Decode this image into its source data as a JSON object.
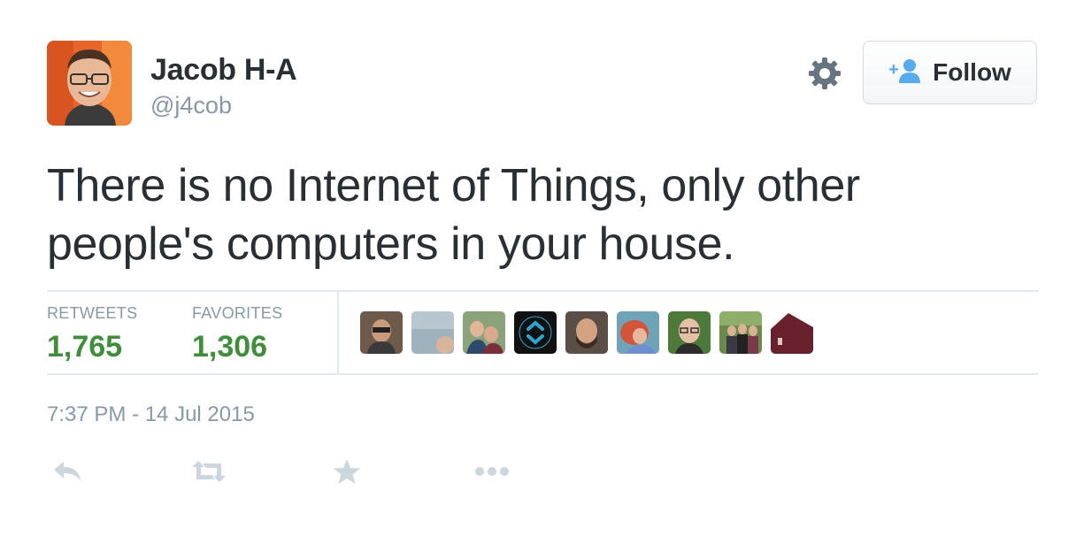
{
  "user": {
    "fullname": "Jacob H-A",
    "username": "@j4cob"
  },
  "follow_button": {
    "label": "Follow"
  },
  "tweet": {
    "text_line1": "There is no Internet of Things, only other",
    "text_line2": "people's computers in your house."
  },
  "stats": {
    "retweets_label": "RETWEETS",
    "retweets_value": "1,765",
    "favorites_label": "FAVORITES",
    "favorites_value": "1,306"
  },
  "timestamp": "7:37 PM - 14 Jul 2015",
  "icons": {
    "settings": "gear-icon",
    "follow": "person-plus-icon",
    "reply": "reply-icon",
    "retweet": "retweet-icon",
    "favorite": "star-icon",
    "more": "more-dots-icon"
  },
  "colors": {
    "text": "#292f33",
    "muted": "#8899a6",
    "stat_value": "#3f8f3a",
    "follow_icon": "#55acee",
    "action_icon": "#ccd6dd",
    "divider": "#e1e8ed"
  }
}
